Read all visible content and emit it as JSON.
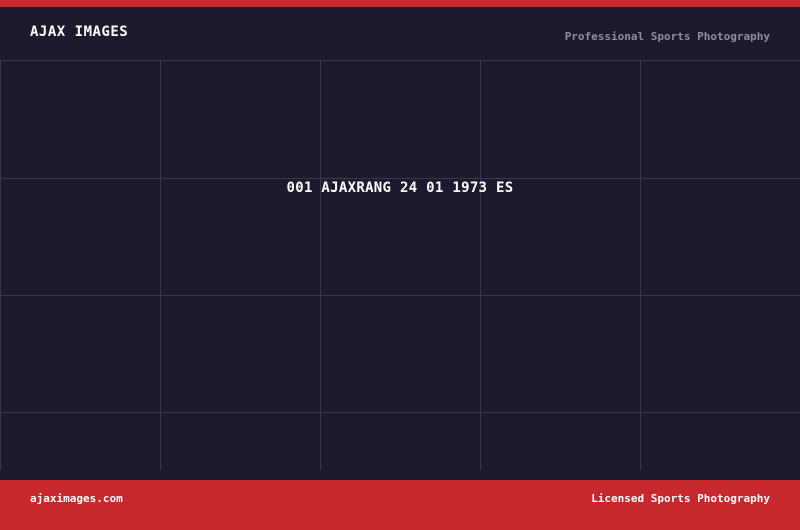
{
  "header": {
    "brand": "AJAX IMAGES",
    "tagline": "Professional Sports Photography"
  },
  "main": {
    "caption": "001 AJAXRANG 24 01 1973 ES"
  },
  "footer": {
    "website": "ajaximages.com",
    "tagline": "Licensed Sports Photography"
  },
  "colors": {
    "background": "#1b1b2d",
    "accent": "#c6282d",
    "grid_line": "#393a4d",
    "muted_text": "#8e8e9e"
  }
}
